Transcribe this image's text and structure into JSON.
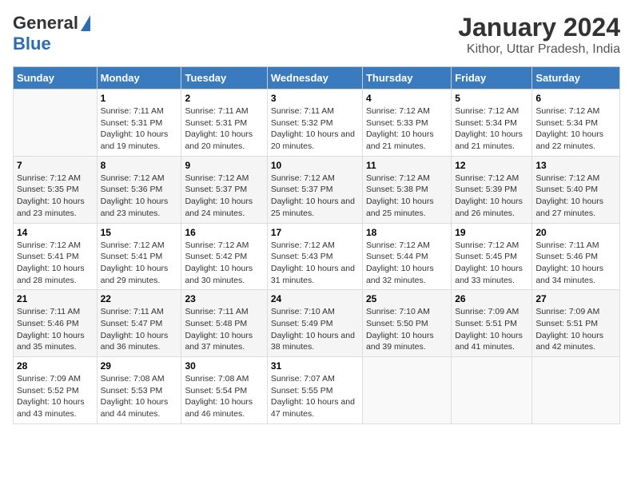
{
  "logo": {
    "general": "General",
    "blue": "Blue"
  },
  "title": "January 2024",
  "subtitle": "Kithor, Uttar Pradesh, India",
  "days_of_week": [
    "Sunday",
    "Monday",
    "Tuesday",
    "Wednesday",
    "Thursday",
    "Friday",
    "Saturday"
  ],
  "weeks": [
    [
      {
        "day": "",
        "sunrise": "",
        "sunset": "",
        "daylight": ""
      },
      {
        "day": "1",
        "sunrise": "Sunrise: 7:11 AM",
        "sunset": "Sunset: 5:31 PM",
        "daylight": "Daylight: 10 hours and 19 minutes."
      },
      {
        "day": "2",
        "sunrise": "Sunrise: 7:11 AM",
        "sunset": "Sunset: 5:31 PM",
        "daylight": "Daylight: 10 hours and 20 minutes."
      },
      {
        "day": "3",
        "sunrise": "Sunrise: 7:11 AM",
        "sunset": "Sunset: 5:32 PM",
        "daylight": "Daylight: 10 hours and 20 minutes."
      },
      {
        "day": "4",
        "sunrise": "Sunrise: 7:12 AM",
        "sunset": "Sunset: 5:33 PM",
        "daylight": "Daylight: 10 hours and 21 minutes."
      },
      {
        "day": "5",
        "sunrise": "Sunrise: 7:12 AM",
        "sunset": "Sunset: 5:34 PM",
        "daylight": "Daylight: 10 hours and 21 minutes."
      },
      {
        "day": "6",
        "sunrise": "Sunrise: 7:12 AM",
        "sunset": "Sunset: 5:34 PM",
        "daylight": "Daylight: 10 hours and 22 minutes."
      }
    ],
    [
      {
        "day": "7",
        "sunrise": "Sunrise: 7:12 AM",
        "sunset": "Sunset: 5:35 PM",
        "daylight": "Daylight: 10 hours and 23 minutes."
      },
      {
        "day": "8",
        "sunrise": "Sunrise: 7:12 AM",
        "sunset": "Sunset: 5:36 PM",
        "daylight": "Daylight: 10 hours and 23 minutes."
      },
      {
        "day": "9",
        "sunrise": "Sunrise: 7:12 AM",
        "sunset": "Sunset: 5:37 PM",
        "daylight": "Daylight: 10 hours and 24 minutes."
      },
      {
        "day": "10",
        "sunrise": "Sunrise: 7:12 AM",
        "sunset": "Sunset: 5:37 PM",
        "daylight": "Daylight: 10 hours and 25 minutes."
      },
      {
        "day": "11",
        "sunrise": "Sunrise: 7:12 AM",
        "sunset": "Sunset: 5:38 PM",
        "daylight": "Daylight: 10 hours and 25 minutes."
      },
      {
        "day": "12",
        "sunrise": "Sunrise: 7:12 AM",
        "sunset": "Sunset: 5:39 PM",
        "daylight": "Daylight: 10 hours and 26 minutes."
      },
      {
        "day": "13",
        "sunrise": "Sunrise: 7:12 AM",
        "sunset": "Sunset: 5:40 PM",
        "daylight": "Daylight: 10 hours and 27 minutes."
      }
    ],
    [
      {
        "day": "14",
        "sunrise": "Sunrise: 7:12 AM",
        "sunset": "Sunset: 5:41 PM",
        "daylight": "Daylight: 10 hours and 28 minutes."
      },
      {
        "day": "15",
        "sunrise": "Sunrise: 7:12 AM",
        "sunset": "Sunset: 5:41 PM",
        "daylight": "Daylight: 10 hours and 29 minutes."
      },
      {
        "day": "16",
        "sunrise": "Sunrise: 7:12 AM",
        "sunset": "Sunset: 5:42 PM",
        "daylight": "Daylight: 10 hours and 30 minutes."
      },
      {
        "day": "17",
        "sunrise": "Sunrise: 7:12 AM",
        "sunset": "Sunset: 5:43 PM",
        "daylight": "Daylight: 10 hours and 31 minutes."
      },
      {
        "day": "18",
        "sunrise": "Sunrise: 7:12 AM",
        "sunset": "Sunset: 5:44 PM",
        "daylight": "Daylight: 10 hours and 32 minutes."
      },
      {
        "day": "19",
        "sunrise": "Sunrise: 7:12 AM",
        "sunset": "Sunset: 5:45 PM",
        "daylight": "Daylight: 10 hours and 33 minutes."
      },
      {
        "day": "20",
        "sunrise": "Sunrise: 7:11 AM",
        "sunset": "Sunset: 5:46 PM",
        "daylight": "Daylight: 10 hours and 34 minutes."
      }
    ],
    [
      {
        "day": "21",
        "sunrise": "Sunrise: 7:11 AM",
        "sunset": "Sunset: 5:46 PM",
        "daylight": "Daylight: 10 hours and 35 minutes."
      },
      {
        "day": "22",
        "sunrise": "Sunrise: 7:11 AM",
        "sunset": "Sunset: 5:47 PM",
        "daylight": "Daylight: 10 hours and 36 minutes."
      },
      {
        "day": "23",
        "sunrise": "Sunrise: 7:11 AM",
        "sunset": "Sunset: 5:48 PM",
        "daylight": "Daylight: 10 hours and 37 minutes."
      },
      {
        "day": "24",
        "sunrise": "Sunrise: 7:10 AM",
        "sunset": "Sunset: 5:49 PM",
        "daylight": "Daylight: 10 hours and 38 minutes."
      },
      {
        "day": "25",
        "sunrise": "Sunrise: 7:10 AM",
        "sunset": "Sunset: 5:50 PM",
        "daylight": "Daylight: 10 hours and 39 minutes."
      },
      {
        "day": "26",
        "sunrise": "Sunrise: 7:09 AM",
        "sunset": "Sunset: 5:51 PM",
        "daylight": "Daylight: 10 hours and 41 minutes."
      },
      {
        "day": "27",
        "sunrise": "Sunrise: 7:09 AM",
        "sunset": "Sunset: 5:51 PM",
        "daylight": "Daylight: 10 hours and 42 minutes."
      }
    ],
    [
      {
        "day": "28",
        "sunrise": "Sunrise: 7:09 AM",
        "sunset": "Sunset: 5:52 PM",
        "daylight": "Daylight: 10 hours and 43 minutes."
      },
      {
        "day": "29",
        "sunrise": "Sunrise: 7:08 AM",
        "sunset": "Sunset: 5:53 PM",
        "daylight": "Daylight: 10 hours and 44 minutes."
      },
      {
        "day": "30",
        "sunrise": "Sunrise: 7:08 AM",
        "sunset": "Sunset: 5:54 PM",
        "daylight": "Daylight: 10 hours and 46 minutes."
      },
      {
        "day": "31",
        "sunrise": "Sunrise: 7:07 AM",
        "sunset": "Sunset: 5:55 PM",
        "daylight": "Daylight: 10 hours and 47 minutes."
      },
      {
        "day": "",
        "sunrise": "",
        "sunset": "",
        "daylight": ""
      },
      {
        "day": "",
        "sunrise": "",
        "sunset": "",
        "daylight": ""
      },
      {
        "day": "",
        "sunrise": "",
        "sunset": "",
        "daylight": ""
      }
    ]
  ]
}
